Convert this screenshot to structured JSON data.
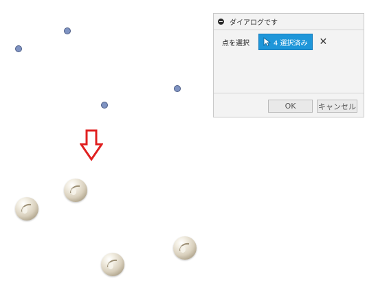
{
  "dialog": {
    "title": "ダイアログです",
    "field_label": "点を選択",
    "selection_button": "4 選択済み",
    "clear_symbol": "✕",
    "ok_label": "OK",
    "cancel_label": "キャンセル"
  },
  "icons": {
    "header": "collapse-icon",
    "selection": "cursor-icon",
    "clear": "close-icon",
    "down_arrow": "arrow-down-icon"
  },
  "colors": {
    "point_fill": "#7f93c2",
    "arrow": "#e02020",
    "select_button": "#1e96d9",
    "sphere": "#d9d0bd"
  }
}
